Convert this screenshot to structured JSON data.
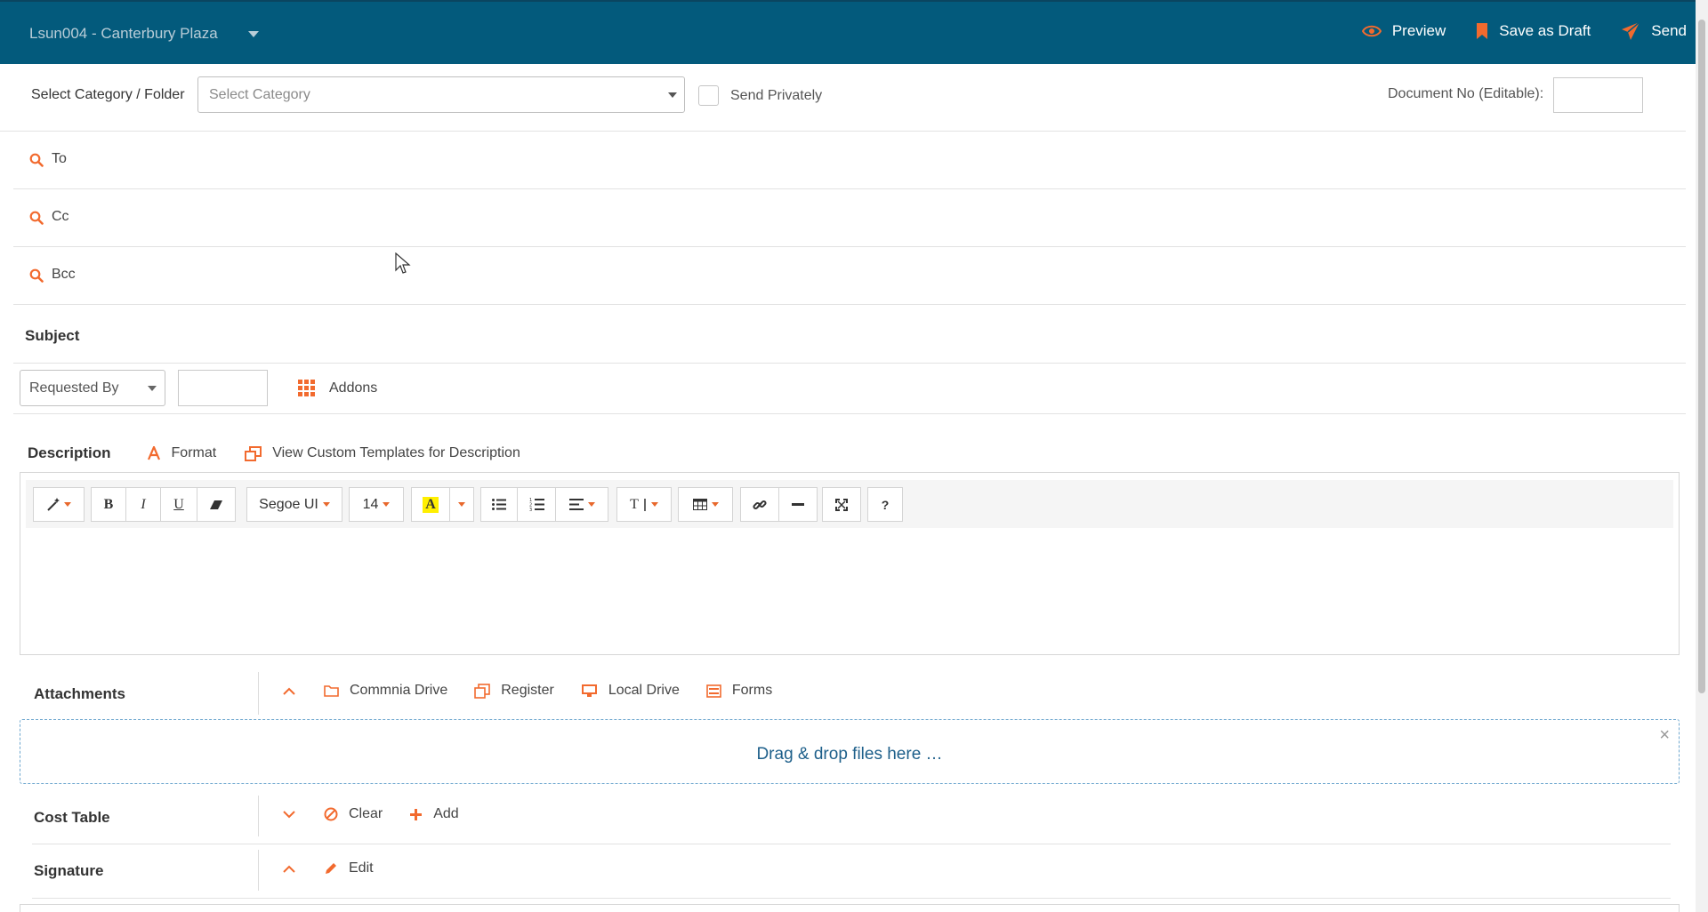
{
  "header": {
    "project": "Lsun004 - Canterbury Plaza",
    "actions": {
      "preview": "Preview",
      "save_draft": "Save as Draft",
      "send": "Send"
    }
  },
  "category": {
    "label": "Select Category / Folder",
    "placeholder": "Select Category",
    "send_privately": "Send Privately",
    "send_privately_checked": false,
    "doc_no_label": "Document No (Editable):",
    "doc_no_value": ""
  },
  "recipients": {
    "to": "To",
    "cc": "Cc",
    "bcc": "Bcc"
  },
  "subject": {
    "label": "Subject"
  },
  "request": {
    "requested_by": "Requested By",
    "value": "",
    "addons": "Addons"
  },
  "description": {
    "title": "Description",
    "format": "Format",
    "templates": "View Custom Templates for Description",
    "toolbar": {
      "bold": "B",
      "italic": "I",
      "underline": "U",
      "font": "Segoe UI",
      "size": "14",
      "highlight": "A",
      "line_height": "T",
      "help": "?"
    }
  },
  "attachments": {
    "title": "Attachments",
    "commnia_drive": "Commnia Drive",
    "register": "Register",
    "local_drive": "Local Drive",
    "forms": "Forms",
    "dropzone": "Drag & drop files here …"
  },
  "cost_table": {
    "title": "Cost Table",
    "clear": "Clear",
    "add": "Add"
  },
  "signature": {
    "title": "Signature",
    "edit": "Edit"
  },
  "colors": {
    "header_bg": "#035a7c",
    "accent": "#f26a2e"
  }
}
